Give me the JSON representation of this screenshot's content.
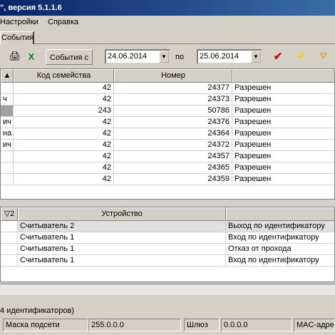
{
  "window": {
    "title": "\", версия 5.1.1.6"
  },
  "menu": {
    "settings": "Настройки",
    "help": "Справка"
  },
  "tab": {
    "label": "События"
  },
  "toolbar": {
    "events_from_label": "События с",
    "date_from": "24.06.2014",
    "to_label": "по",
    "date_to": "25.06.2014"
  },
  "upper_table": {
    "columns": [
      "Код семейства",
      "Номер",
      ""
    ],
    "rows": [
      {
        "left": "",
        "family": "42",
        "number": "24377",
        "status": "Разрешен"
      },
      {
        "left": "ч",
        "family": "42",
        "number": "24373",
        "status": "Разрешен"
      },
      {
        "left": "",
        "family": "243",
        "number": "50786",
        "status": "Разрешен"
      },
      {
        "left": "ич",
        "family": "42",
        "number": "24376",
        "status": "Разрешен"
      },
      {
        "left": "на",
        "family": "42",
        "number": "24364",
        "status": "Разрешен"
      },
      {
        "left": "ич",
        "family": "42",
        "number": "24372",
        "status": "Разрешен"
      },
      {
        "left": "",
        "family": "42",
        "number": "24357",
        "status": "Разрешен"
      },
      {
        "left": "",
        "family": "42",
        "number": "24365",
        "status": "Разрешен"
      },
      {
        "left": "",
        "family": "42",
        "number": "24359",
        "status": "Разрешен"
      }
    ]
  },
  "lower_table": {
    "sort_indicator": "2",
    "columns": [
      "Устройство",
      ""
    ],
    "rows": [
      {
        "device": "Считыватель 2",
        "event": "Выход по идентификатору"
      },
      {
        "device": "Считыватель 1",
        "event": "Вход по идентификатору"
      },
      {
        "device": "Считыватель 1",
        "event": "Отказ от прохода"
      },
      {
        "device": "Считыватель 1",
        "event": "Вход по идентификатору"
      }
    ]
  },
  "status": {
    "ids_text": "4 идентификаторов)",
    "mask_label": "Маска подсети",
    "mask_value": "255.0.0.0",
    "gateway_label": "Шлюз",
    "gateway_value": "0.0.0.0",
    "mac_label": "MAC-адре"
  },
  "colors": {
    "title_start": "#0a246a",
    "title_end": "#3a6ea5",
    "selected_row": "#a0a0a0"
  }
}
